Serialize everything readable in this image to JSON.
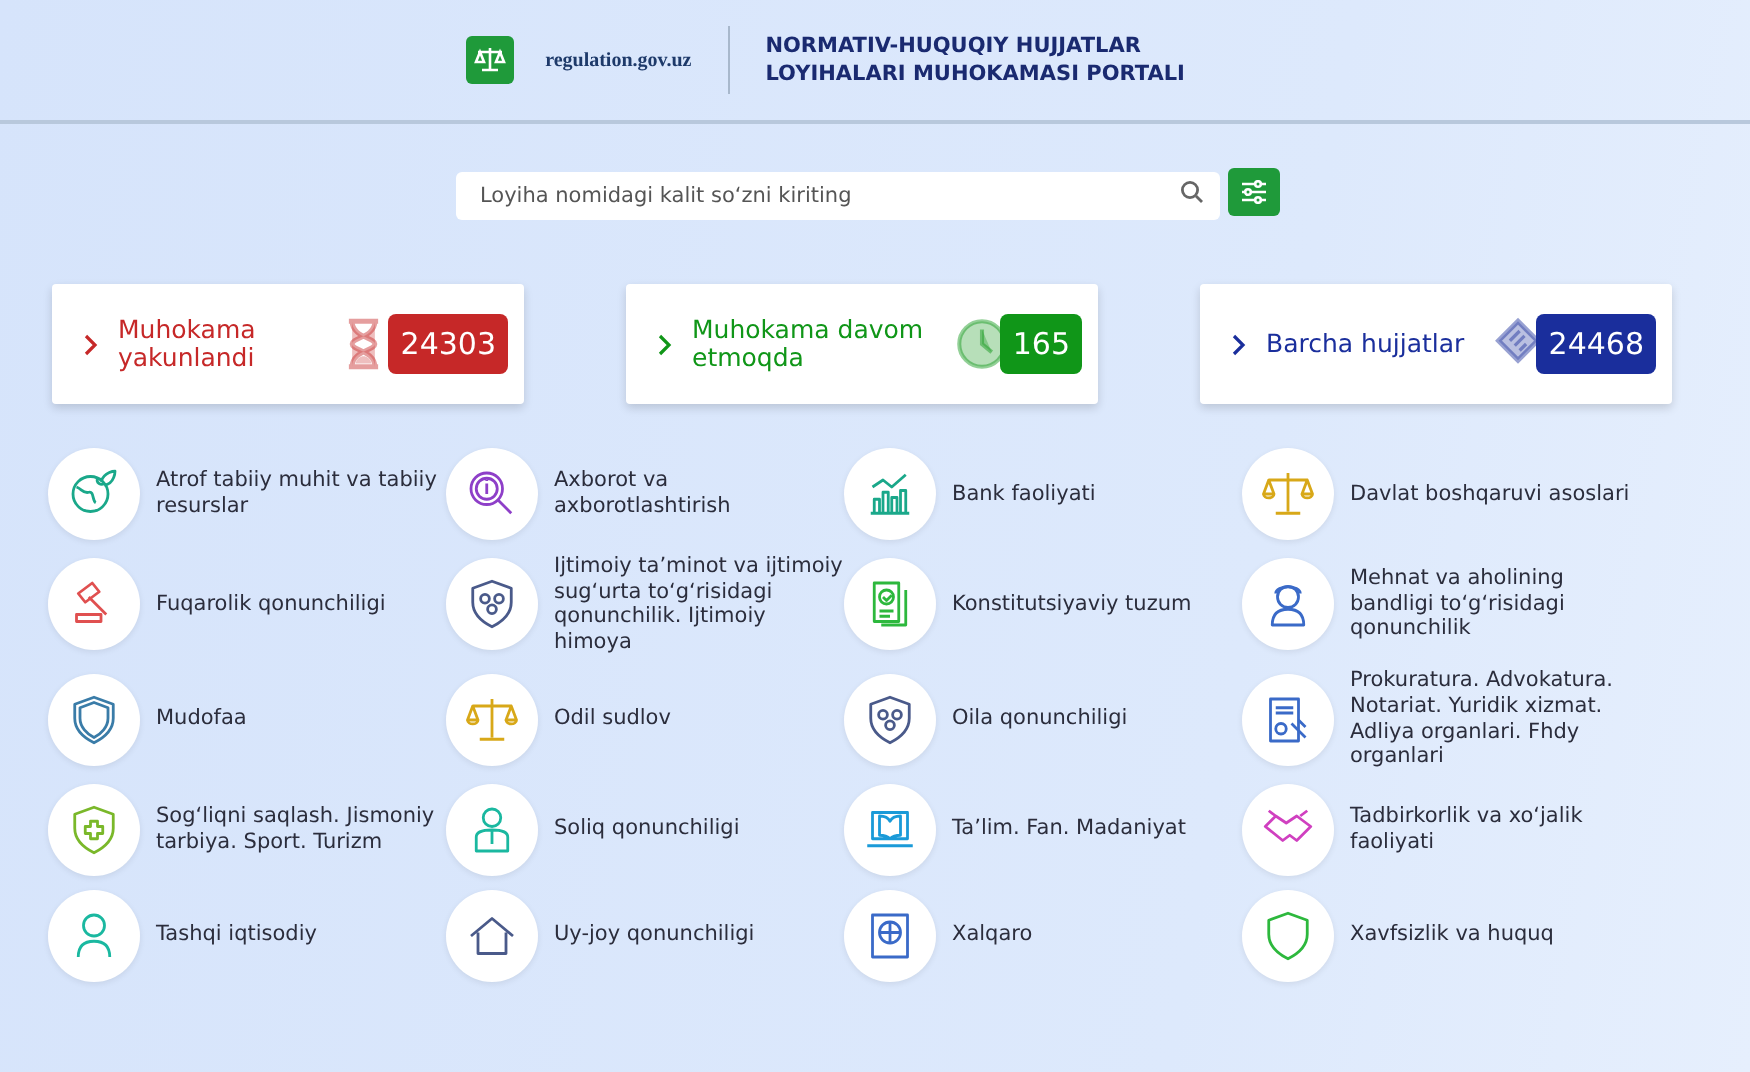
{
  "header": {
    "site": "regulation.gov.uz",
    "title_lines": [
      "NORMATIV-HUQUQIY HUJJATLAR",
      "LOYIHALARI MUHOKAMASI PORTALI"
    ]
  },
  "search": {
    "placeholder": "Loyiha nomidagi kalit so‘zni kiriting"
  },
  "stats": [
    {
      "kind": "finished",
      "label": "Muhokama yakunlandi",
      "count": "24303",
      "color": "#c62828"
    },
    {
      "kind": "ongoing",
      "label": "Muhokama davom etmoqda",
      "count": "165",
      "color": "#109618"
    },
    {
      "kind": "all",
      "label": "Barcha hujjatlar",
      "count": "24468",
      "color": "#1a2e9c"
    }
  ],
  "categories": [
    {
      "label": "Atrof tabiiy muhit va tabiiy resurslar",
      "color": "#1aa88a"
    },
    {
      "label": "Axborot va axborotlashtirish",
      "color": "#8e3fc8"
    },
    {
      "label": "Bank faoliyati",
      "color": "#1aa88a"
    },
    {
      "label": "Davlat boshqaruvi asoslari",
      "color": "#d8a818"
    },
    {
      "label": "Fuqarolik qonunchiligi",
      "color": "#e05050"
    },
    {
      "label": "Ijtimoiy ta’minot va ijtimoiy sug‘urta to‘g‘risidagi qonunchilik. Ijtimoiy himoya",
      "color": "#4a5a8a"
    },
    {
      "label": "Konstitutsiyaviy tuzum",
      "color": "#2db83d"
    },
    {
      "label": "Mehnat va aholining bandligi to‘g‘risidagi qonunchilik",
      "color": "#3a6ac8"
    },
    {
      "label": "Mudofaa",
      "color": "#3a7ca8"
    },
    {
      "label": "Odil sudlov",
      "color": "#d8a818"
    },
    {
      "label": "Oila qonunchiligi",
      "color": "#4a5a8a"
    },
    {
      "label": "Prokuratura. Advokatura. Notariat. Yuridik xizmat. Adliya organlari. Fhdy organlari",
      "color": "#3a6ac8"
    },
    {
      "label": "Sog‘liqni saqlash. Jismoniy tarbiya. Sport. Turizm",
      "color": "#7ab82a"
    },
    {
      "label": "Soliq qonunchiligi",
      "color": "#1ab8a0"
    },
    {
      "label": "Ta’lim. Fan. Madaniyat",
      "color": "#1a9ad8"
    },
    {
      "label": "Tadbirkorlik va xo‘jalik faoliyati",
      "color": "#d040c0"
    },
    {
      "label": "Tashqi iqtisodiy",
      "color": "#1ab8a0"
    },
    {
      "label": "Uy-joy qonunchiligi",
      "color": "#4a5a8a"
    },
    {
      "label": "Xalqaro",
      "color": "#3a6ac8"
    },
    {
      "label": "Xavfsizlik va huquq",
      "color": "#2db83d"
    }
  ]
}
